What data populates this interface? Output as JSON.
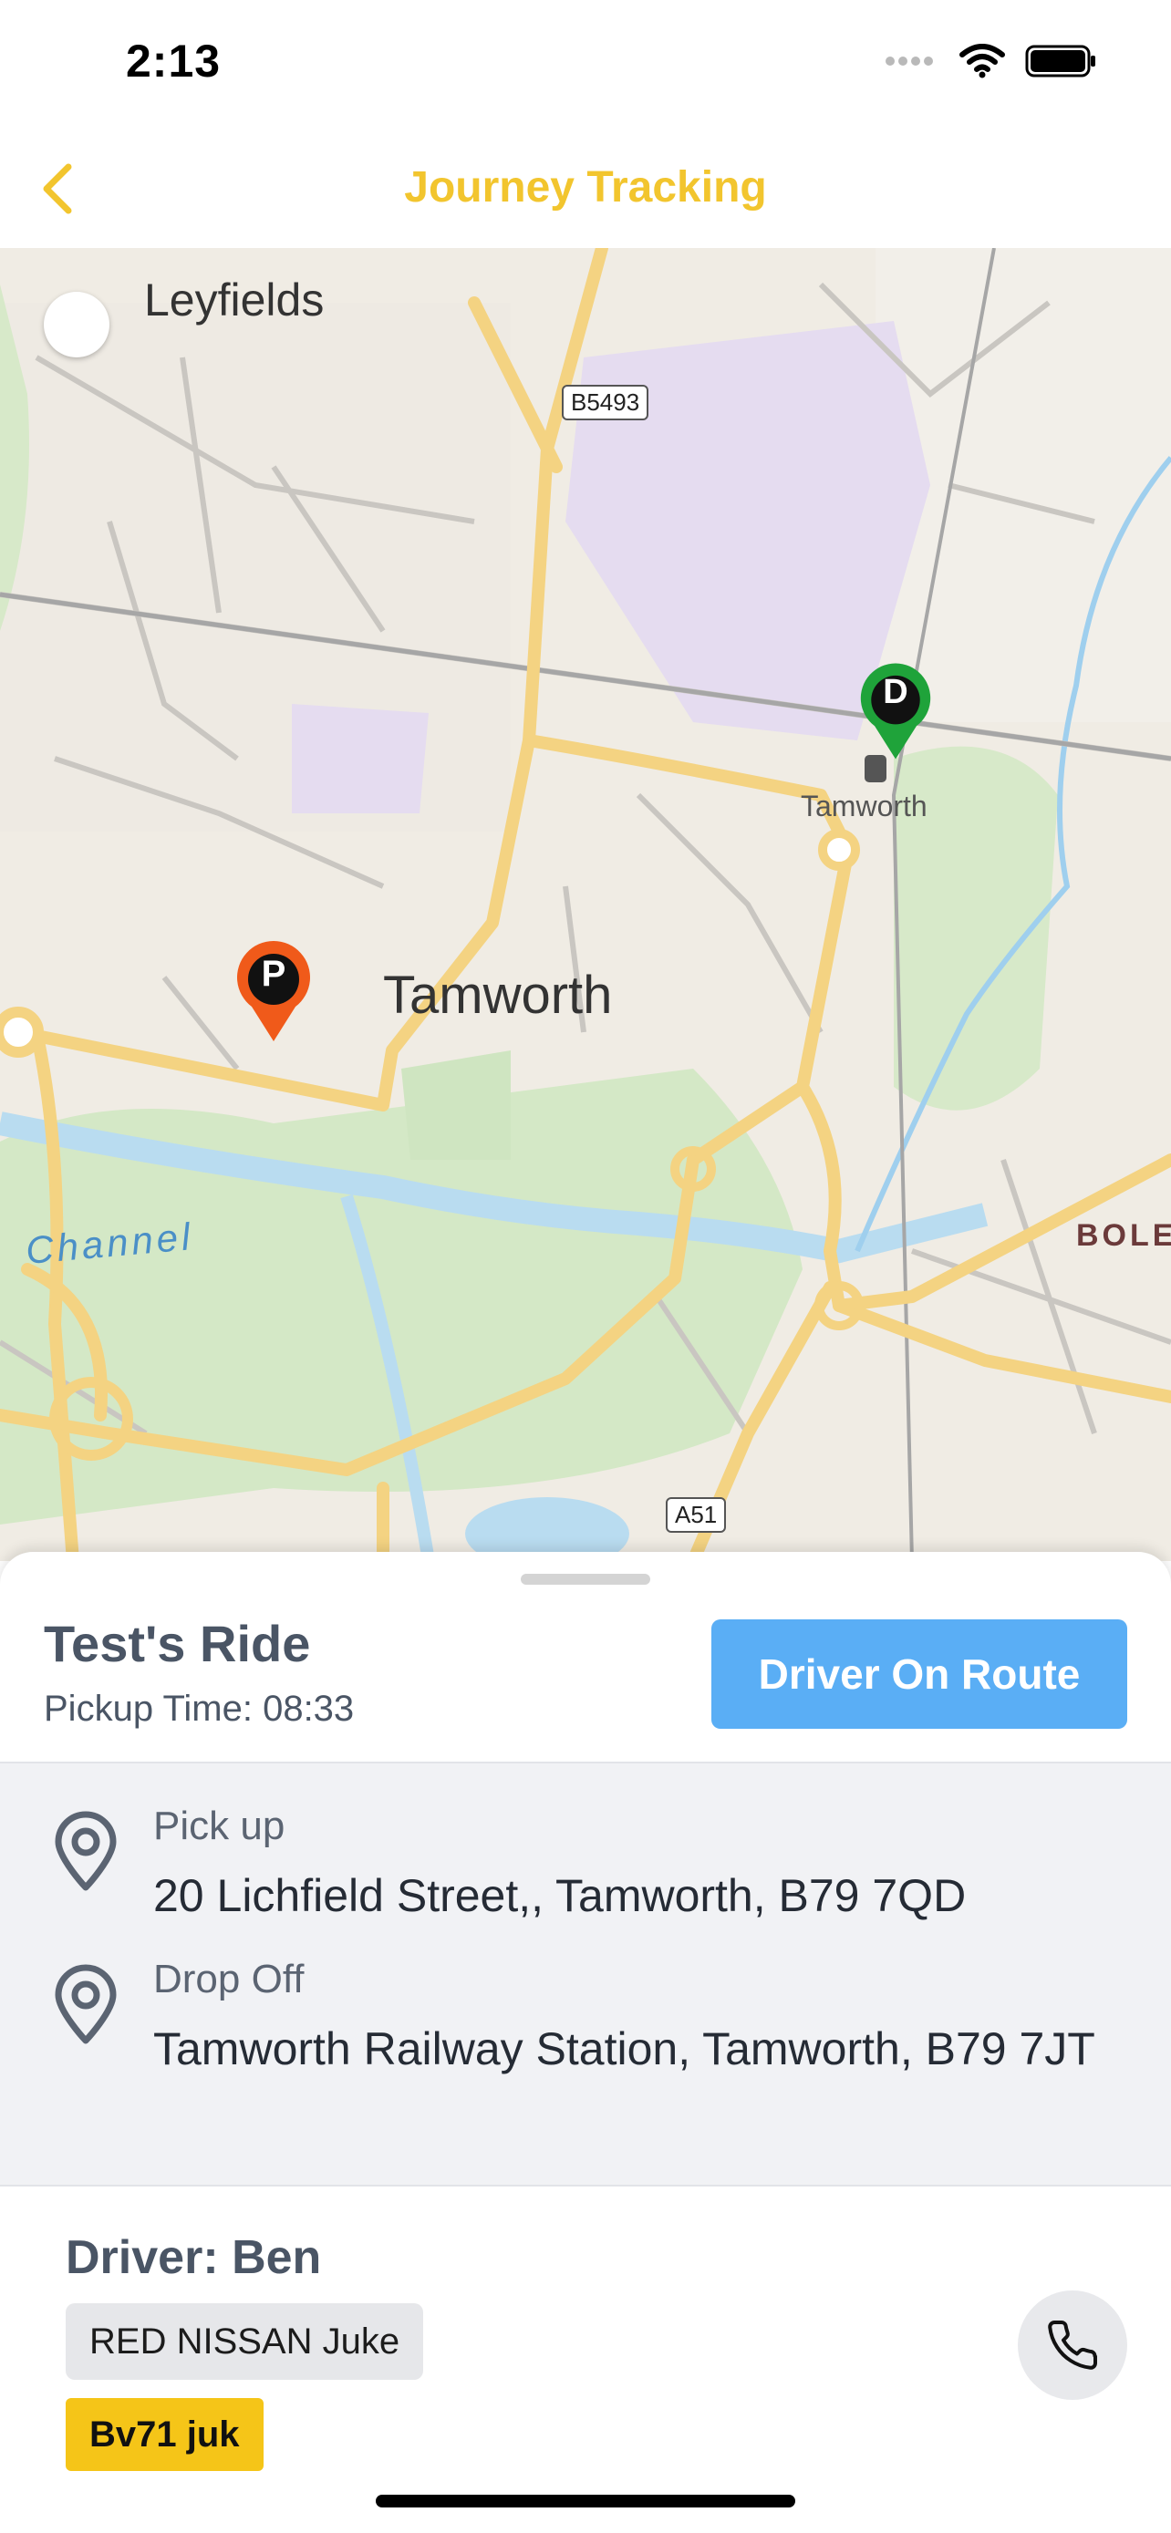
{
  "status_bar": {
    "time": "2:13"
  },
  "nav": {
    "title": "Journey Tracking"
  },
  "map": {
    "labels": {
      "area_leyfields": "Leyfields",
      "town_tamworth": "Tamworth",
      "station_tamworth": "Tamworth",
      "channel": "Channel",
      "bole": "BOLE"
    },
    "road_shields": {
      "b5493": "B5493",
      "a51": "A51"
    },
    "pins": {
      "pickup_letter": "P",
      "dropoff_letter": "D"
    },
    "colors": {
      "pickup_pin": "#f05a1a",
      "dropoff_pin": "#1fa33a"
    }
  },
  "ride": {
    "title": "Test's Ride",
    "pickup_time": "Pickup Time: 08:33",
    "status_button": "Driver On Route"
  },
  "addresses": {
    "pickup": {
      "label": "Pick up",
      "value": "20 Lichfield Street,, Tamworth, B79 7QD"
    },
    "dropoff": {
      "label": "Drop Off",
      "value": "Tamworth Railway Station, Tamworth, B79 7JT"
    }
  },
  "driver": {
    "name": "Driver: Ben",
    "car": "RED NISSAN Juke",
    "plate": "Bv71 juk"
  },
  "icons": {
    "back": "chevron-left-icon",
    "location": "map-pin-icon",
    "call": "phone-icon"
  },
  "theme": {
    "accent": "#f2c52e",
    "button_blue": "#5aaef5",
    "plate_yellow": "#f5c518"
  }
}
